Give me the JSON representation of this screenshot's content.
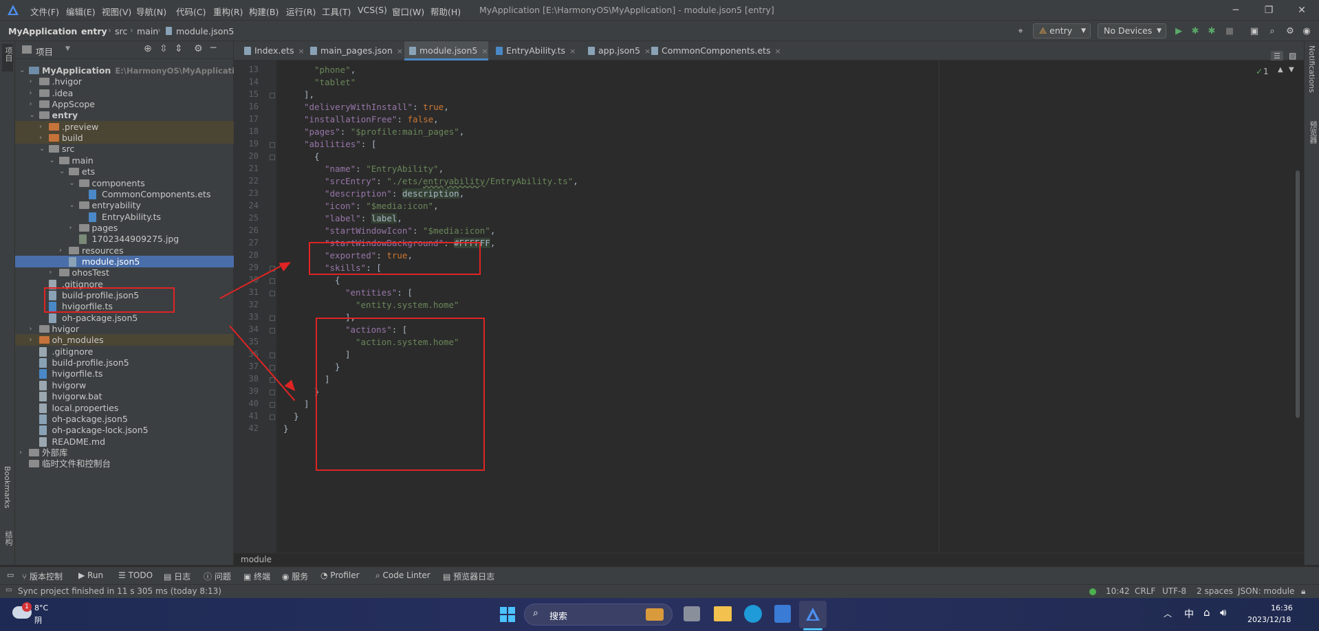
{
  "titlebar": {
    "menus": [
      "文件(F)",
      "编辑(E)",
      "视图(V)",
      "导航(N)",
      "代码(C)",
      "重构(R)",
      "构建(B)",
      "运行(R)",
      "工具(T)",
      "VCS(S)",
      "窗口(W)",
      "帮助(H)"
    ],
    "title": "MyApplication [E:\\HarmonyOS\\MyApplication] - module.json5 [entry]"
  },
  "navbar": {
    "crumbs": [
      "MyApplication",
      "entry",
      "src",
      "main",
      "module.json5"
    ],
    "run_config": "entry",
    "device": "No Devices"
  },
  "left_strip": {
    "project": "项目",
    "bookmarks": "Bookmarks",
    "structure": "结构"
  },
  "right_strip": {
    "notifications": "Notifications",
    "preview": "预览器"
  },
  "project_panel": {
    "title": "项目",
    "tree": [
      {
        "label": "MyApplication",
        "path": "E:\\HarmonyOS\\MyApplication"
      },
      {
        "label": ".hvigor"
      },
      {
        "label": ".idea"
      },
      {
        "label": "AppScope"
      },
      {
        "label": "entry"
      },
      {
        "label": ".preview"
      },
      {
        "label": "build"
      },
      {
        "label": "src"
      },
      {
        "label": "main"
      },
      {
        "label": "ets"
      },
      {
        "label": "components"
      },
      {
        "label": "CommonComponents.ets"
      },
      {
        "label": "entryability"
      },
      {
        "label": "EntryAbility.ts"
      },
      {
        "label": "pages"
      },
      {
        "label": "1702344909275.jpg"
      },
      {
        "label": "resources"
      },
      {
        "label": "module.json5"
      },
      {
        "label": "ohosTest"
      },
      {
        "label": ".gitignore"
      },
      {
        "label": "build-profile.json5"
      },
      {
        "label": "hvigorfile.ts"
      },
      {
        "label": "oh-package.json5"
      },
      {
        "label": "hvigor"
      },
      {
        "label": "oh_modules"
      },
      {
        "label": ".gitignore"
      },
      {
        "label": "build-profile.json5"
      },
      {
        "label": "hvigorfile.ts"
      },
      {
        "label": "hvigorw"
      },
      {
        "label": "hvigorw.bat"
      },
      {
        "label": "local.properties"
      },
      {
        "label": "oh-package.json5"
      },
      {
        "label": "oh-package-lock.json5"
      },
      {
        "label": "README.md"
      },
      {
        "label": "外部库"
      },
      {
        "label": "临时文件和控制台"
      }
    ]
  },
  "tabs": [
    "Index.ets",
    "main_pages.json",
    "module.json5",
    "EntryAbility.ts",
    "app.json5",
    "CommonComponents.ets"
  ],
  "editor": {
    "inspection_count": "1",
    "line_numbers": [
      "13",
      "14",
      "15",
      "16",
      "17",
      "18",
      "19",
      "20",
      "21",
      "22",
      "23",
      "24",
      "25",
      "26",
      "27",
      "28",
      "29",
      "30",
      "31",
      "32",
      "33",
      "34",
      "35",
      "36",
      "37",
      "38",
      "39",
      "40",
      "41",
      "42"
    ],
    "lines": [
      {
        "t": [
          [
            "s",
            "\"phone\""
          ],
          [
            "p",
            ","
          ]
        ]
      },
      {
        "t": [
          [
            "s",
            "\"tablet\""
          ]
        ]
      },
      {
        "t": [
          [
            "p",
            "],"
          ]
        ]
      },
      {
        "t": [
          [
            "k",
            "\"deliveryWithInstall\""
          ],
          [
            "p",
            ": "
          ],
          [
            "kw",
            "true"
          ],
          [
            "p",
            ","
          ]
        ]
      },
      {
        "t": [
          [
            "k",
            "\"installationFree\""
          ],
          [
            "p",
            ": "
          ],
          [
            "kw",
            "false"
          ],
          [
            "p",
            ","
          ]
        ]
      },
      {
        "t": [
          [
            "k",
            "\"pages\""
          ],
          [
            "p",
            ": "
          ],
          [
            "s",
            "\"$profile:main_pages\""
          ],
          [
            "p",
            ","
          ]
        ]
      },
      {
        "t": [
          [
            "k",
            "\"abilities\""
          ],
          [
            "p",
            ": ["
          ]
        ]
      },
      {
        "t": [
          [
            "p",
            "{"
          ]
        ]
      },
      {
        "t": [
          [
            "k",
            "\"name\""
          ],
          [
            "p",
            ": "
          ],
          [
            "s",
            "\"EntryAbility\""
          ],
          [
            "p",
            ","
          ]
        ]
      },
      {
        "t": [
          [
            "k",
            "\"srcEntry\""
          ],
          [
            "p",
            ": "
          ],
          [
            "s",
            "\"./ets/"
          ],
          [
            "su",
            "entryability"
          ],
          [
            "s",
            "/EntryAbility.ts\""
          ],
          [
            "p",
            ","
          ]
        ]
      },
      {
        "t": [
          [
            "k",
            "\"description\""
          ],
          [
            "p",
            ": "
          ],
          [
            "h",
            "description"
          ],
          [
            "p",
            ","
          ]
        ]
      },
      {
        "t": [
          [
            "k",
            "\"icon\""
          ],
          [
            "p",
            ": "
          ],
          [
            "s",
            "\"$media:icon\""
          ],
          [
            "p",
            ","
          ]
        ]
      },
      {
        "t": [
          [
            "k",
            "\"label\""
          ],
          [
            "p",
            ": "
          ],
          [
            "h",
            "label"
          ],
          [
            "p",
            ","
          ]
        ]
      },
      {
        "t": [
          [
            "k",
            "\"startWindowIcon\""
          ],
          [
            "p",
            ": "
          ],
          [
            "s",
            "\"$media:icon\""
          ],
          [
            "p",
            ","
          ]
        ]
      },
      {
        "t": [
          [
            "k",
            "\"startWindowBackground\""
          ],
          [
            "p",
            ": "
          ],
          [
            "h",
            "#FFFFFF"
          ],
          [
            "p",
            ","
          ]
        ]
      },
      {
        "t": [
          [
            "k",
            "\"exported\""
          ],
          [
            "p",
            ": "
          ],
          [
            "kw",
            "true"
          ],
          [
            "p",
            ","
          ]
        ]
      },
      {
        "t": [
          [
            "k",
            "\"skills\""
          ],
          [
            "p",
            ": ["
          ]
        ]
      },
      {
        "t": [
          [
            "p",
            "{"
          ]
        ]
      },
      {
        "t": [
          [
            "k",
            "\"entities\""
          ],
          [
            "p",
            ": ["
          ]
        ]
      },
      {
        "t": [
          [
            "s",
            "\"entity.system.home\""
          ]
        ]
      },
      {
        "t": [
          [
            "p",
            "],"
          ]
        ]
      },
      {
        "t": [
          [
            "k",
            "\"actions\""
          ],
          [
            "p",
            ": ["
          ]
        ]
      },
      {
        "t": [
          [
            "s",
            "\"action.system.home\""
          ]
        ]
      },
      {
        "t": [
          [
            "p",
            "]"
          ]
        ]
      },
      {
        "t": [
          [
            "p",
            "}"
          ]
        ]
      },
      {
        "t": [
          [
            "p",
            "]"
          ]
        ]
      },
      {
        "t": [
          [
            "p",
            "}"
          ]
        ]
      },
      {
        "t": [
          [
            "p",
            "]"
          ]
        ]
      },
      {
        "t": [
          [
            "p",
            "}"
          ]
        ]
      },
      {
        "t": [
          [
            "p",
            "}"
          ]
        ]
      }
    ],
    "breadcrumb": "module"
  },
  "tool_windows": [
    "版本控制",
    "Run",
    "TODO",
    "日志",
    "问题",
    "终端",
    "服务",
    "Profiler",
    "Code Linter",
    "预览器日志"
  ],
  "statusbar": {
    "message": "Sync project finished in 11 s 305 ms (today 8:13)",
    "position": "10:42",
    "line_sep": "CRLF",
    "encoding": "UTF-8",
    "indent": "2 spaces",
    "schema": "JSON: module"
  },
  "taskbar": {
    "weather_temp": "8°C",
    "weather_desc": "阴",
    "weather_badge": "1",
    "search": "搜索",
    "ime": "中",
    "time": "16:36",
    "date": "2023/12/18"
  },
  "colors": {
    "accent": "#4a88c7",
    "annotation": "#e02424"
  }
}
